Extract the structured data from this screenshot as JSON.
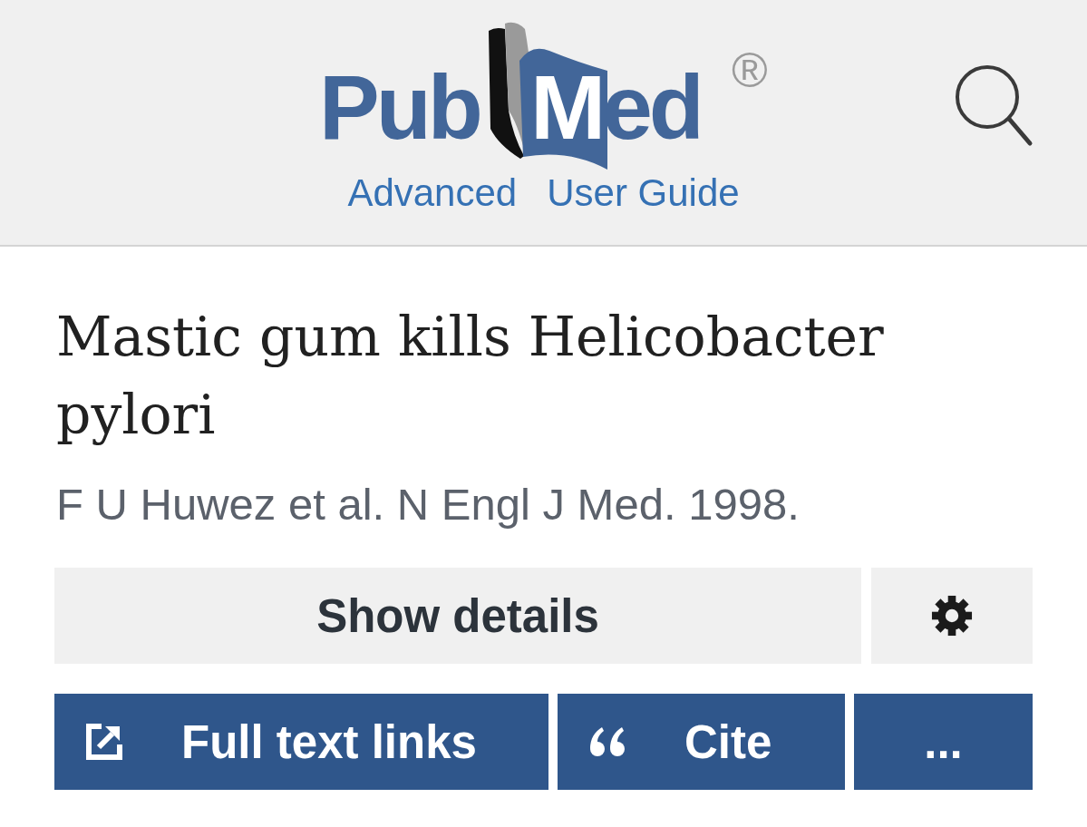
{
  "header": {
    "logo": {
      "left_text": "Pub",
      "right_text": "Med",
      "registered_mark": "®"
    },
    "links": [
      "Advanced",
      "User Guide"
    ]
  },
  "article": {
    "title": "Mastic gum kills Helicobacter pylori",
    "byline": "F U Huwez et al. N Engl J Med. 1998."
  },
  "detail_bar": {
    "show_details_label": "Show details"
  },
  "actions": [
    {
      "kind": "external",
      "label": "Full text links"
    },
    {
      "kind": "cite",
      "label": "Cite"
    },
    {
      "kind": "more",
      "label": "..."
    }
  ]
}
